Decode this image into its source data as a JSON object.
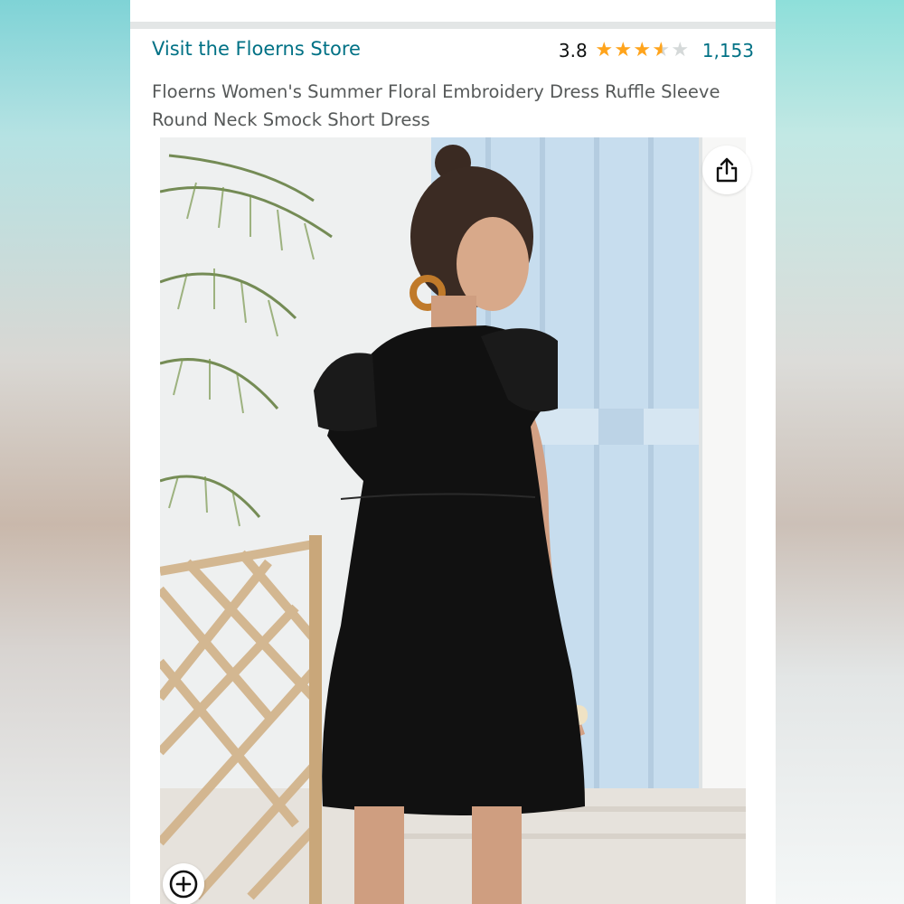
{
  "product": {
    "store_link": "Visit the Floerns Store",
    "rating_value": "3.8",
    "rating_stars": 3.8,
    "review_count": "1,153",
    "title": "Floerns Women's Summer Floral Embroidery Dress Ruffle Sleeve Round Neck Smock Short Dress"
  },
  "icons": {
    "share": "share-icon",
    "zoom": "zoom-plus-icon",
    "star": "star-icon"
  },
  "colors": {
    "link": "#007185",
    "star": "#ffa41c",
    "title_text": "#565959",
    "dress": "#111111"
  }
}
